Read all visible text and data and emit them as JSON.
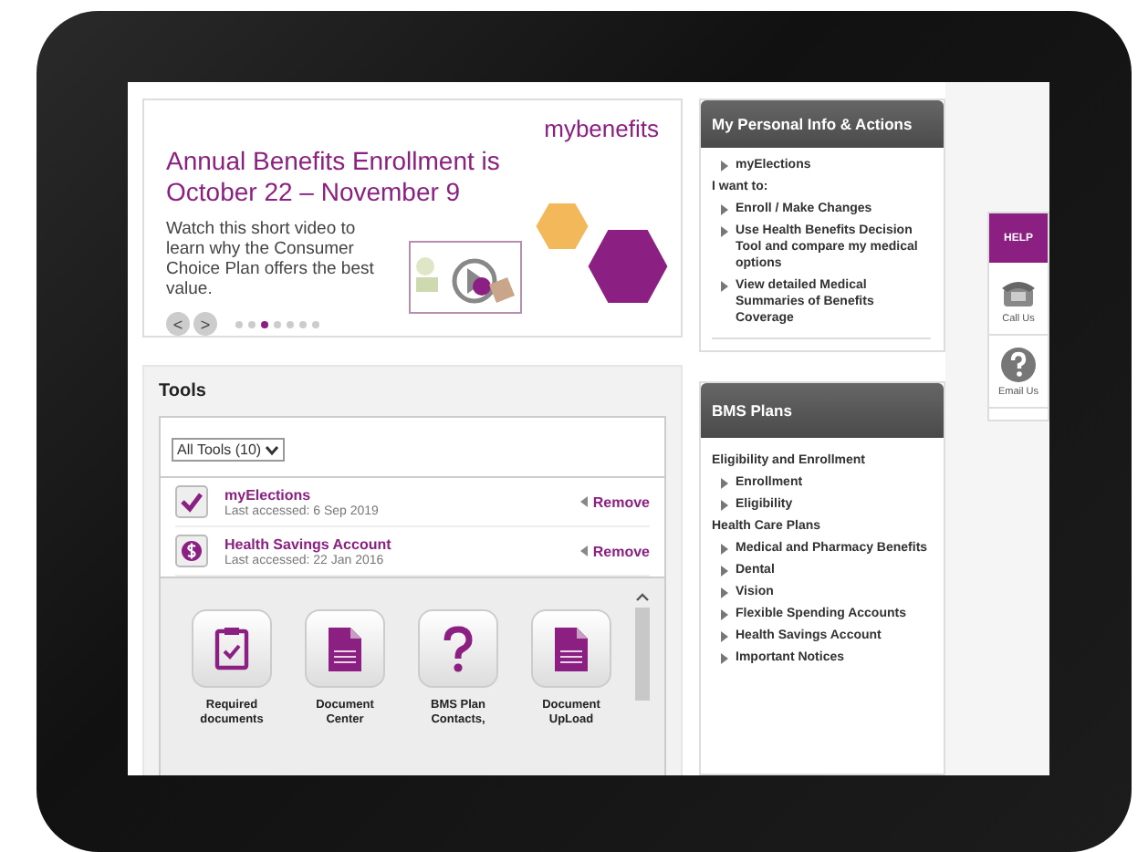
{
  "banner": {
    "brand": "mybenefits",
    "title": "Annual Benefits Enrollment is October 22 – November 9",
    "text": "Watch this short video to learn why the Consumer Choice Plan offers the best value.",
    "prev": "<",
    "next": ">",
    "dots": [
      {
        "selected": false
      },
      {
        "selected": false
      },
      {
        "selected": true
      },
      {
        "selected": false
      },
      {
        "selected": false
      },
      {
        "selected": false
      },
      {
        "selected": false
      }
    ]
  },
  "tools": {
    "title": "Tools",
    "filter": "All Tools (10)",
    "items": [
      {
        "kind": "check",
        "name": "myElections",
        "accessed": "Last accessed: 6 Sep 2019",
        "action": "Remove"
      },
      {
        "kind": "dollar",
        "name": "Health Savings Account",
        "accessed": "Last accessed: 22 Jan 2016",
        "action": "Remove"
      }
    ],
    "tiles": [
      {
        "kind": "clipboard",
        "label": "Required documents"
      },
      {
        "kind": "document",
        "label": "Document Center"
      },
      {
        "kind": "question",
        "label": "BMS Plan Contacts,"
      },
      {
        "kind": "document",
        "label": "Document UpLoad"
      }
    ]
  },
  "personal": {
    "title": "My Personal Info & Actions",
    "link": "myElections",
    "intro": "I want to:",
    "links": [
      "Enroll / Make Changes",
      "Use Health Benefits Decision Tool and compare my medical options",
      "View detailed Medical Summaries of Benefits Coverage"
    ]
  },
  "plans": {
    "title": "BMS Plans",
    "groups": [
      {
        "heading": "Eligibility and Enrollment",
        "links": [
          "Enrollment",
          "Eligibility"
        ]
      },
      {
        "heading": "Health Care Plans",
        "links": [
          "Medical and Pharmacy Benefits",
          "Dental",
          "Vision",
          "Flexible Spending Accounts",
          "Health Savings Account",
          "Important Notices"
        ]
      }
    ]
  },
  "help": {
    "title": "HELP",
    "items": [
      {
        "kind": "phone",
        "label": "Call Us"
      },
      {
        "kind": "question",
        "label": "Email Us"
      }
    ]
  }
}
